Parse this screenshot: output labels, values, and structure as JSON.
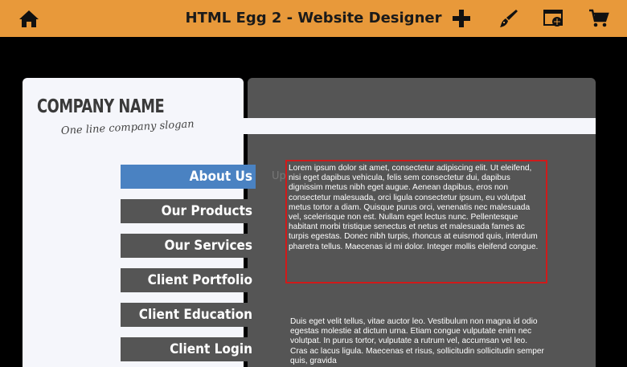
{
  "app": {
    "title": "HTML Egg 2 - Website Designer",
    "accent": "#e8993a",
    "icons": [
      "home-icon",
      "add-icon",
      "paintbrush-icon",
      "browser-globe-icon",
      "cart-icon"
    ]
  },
  "site": {
    "company_name": "COMPANY NAME",
    "slogan": "One line company slogan",
    "nav": [
      {
        "label": "About Us",
        "active": true
      },
      {
        "label": "Our Products"
      },
      {
        "label": "Our Services"
      },
      {
        "label": "Client Portfolio"
      },
      {
        "label": "Client Education"
      },
      {
        "label": "Client Login"
      }
    ],
    "ghost_text": "Up",
    "paragraph1": "Lorem ipsum dolor sit amet, consectetur adipiscing elit. Ut eleifend, nisi eget dapibus vehicula, felis sem consectetur dui, dapibus dignissim metus nibh eget augue. Aenean dapibus, eros non consectetur malesuada, orci ligula consectetur ipsum, eu volutpat metus tortor a diam. Quisque purus orci, venenatis nec malesuada vel, scelerisque non est. Nullam eget lectus nunc. Pellentesque habitant morbi tristique senectus et netus et malesuada fames ac turpis egestas. Donec nibh turpis, rhoncus at euismod quis, interdum pharetra tellus. Maecenas id mi dolor. Integer mollis eleifend congue.",
    "paragraph2": "Duis eget velit tellus, vitae auctor leo. Vestibulum non magna id odio egestas molestie at dictum urna. Etiam congue vulputate enim nec volutpat. In purus tortor, vulputate a rutrum vel, accumsan vel leo. Cras ac lacus ligula. Maecenas et risus, sollicitudin sollicitudin semper quis, gravida"
  }
}
